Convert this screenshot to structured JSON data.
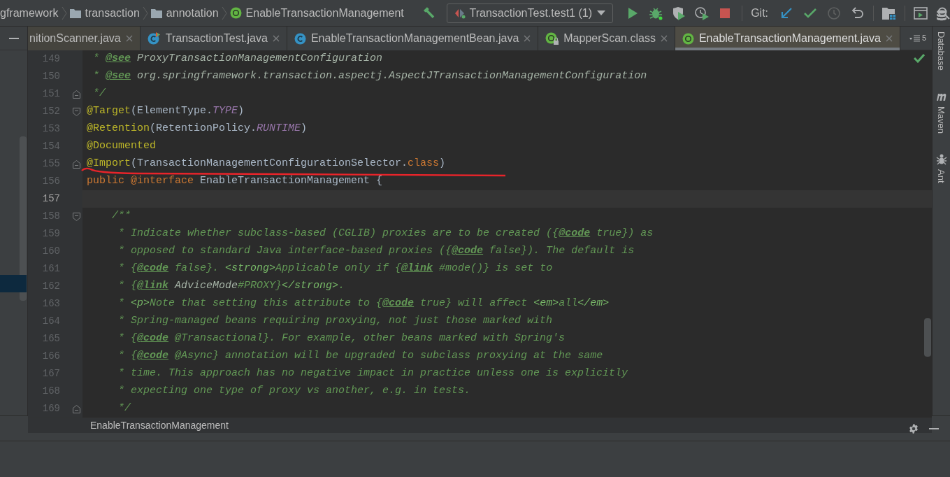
{
  "breadcrumbs": [
    {
      "kind": "plain",
      "label": "gframework"
    },
    {
      "kind": "folder",
      "label": "transaction"
    },
    {
      "kind": "folder",
      "label": "annotation"
    },
    {
      "kind": "annotation",
      "label": "EnableTransactionManagement"
    }
  ],
  "toolbar": {
    "run_config": "TransactionTest.test1 (1)",
    "vcs_label": "Git:"
  },
  "tabs": [
    {
      "kind": "plain",
      "label": "nitionScanner.java",
      "selected": false
    },
    {
      "kind": "test-class",
      "label": "TransactionTest.java",
      "selected": false
    },
    {
      "kind": "class",
      "label": "EnableTransactionManagementBean.java",
      "selected": false
    },
    {
      "kind": "annotation-locked",
      "label": "MapperScan.class",
      "selected": false
    },
    {
      "kind": "annotation",
      "label": "EnableTransactionManagement.java",
      "selected": true
    }
  ],
  "tab_overflow": "5",
  "editor": {
    "lines": [
      {
        "number": "149",
        "current": false,
        "fold_start": false,
        "fold_end": false,
        "tokens": [
          {
            "kind": "doc",
            "text": " * "
          },
          {
            "kind": "doctag",
            "text": "@see"
          },
          {
            "kind": "docref",
            "text": " ProxyTransactionManagementConfiguration"
          }
        ]
      },
      {
        "number": "150",
        "current": false,
        "fold_start": false,
        "fold_end": false,
        "tokens": [
          {
            "kind": "doc",
            "text": " * "
          },
          {
            "kind": "doctag",
            "text": "@see"
          },
          {
            "kind": "docref",
            "text": " org.springframework.transaction.aspectj.AspectJTransactionManagementConfiguration"
          }
        ]
      },
      {
        "number": "151",
        "current": false,
        "fold_start": false,
        "fold_end": true,
        "tokens": [
          {
            "kind": "doc",
            "text": " */"
          }
        ]
      },
      {
        "number": "152",
        "current": false,
        "fold_start": true,
        "fold_end": false,
        "tokens": [
          {
            "kind": "annotation",
            "text": "@Target"
          },
          {
            "kind": "plain",
            "text": "(ElementType."
          },
          {
            "kind": "constant",
            "text": "TYPE"
          },
          {
            "kind": "plain",
            "text": ")"
          }
        ]
      },
      {
        "number": "153",
        "current": false,
        "fold_start": false,
        "fold_end": false,
        "tokens": [
          {
            "kind": "annotation",
            "text": "@Retention"
          },
          {
            "kind": "plain",
            "text": "(RetentionPolicy."
          },
          {
            "kind": "constant",
            "text": "RUNTIME"
          },
          {
            "kind": "plain",
            "text": ")"
          }
        ]
      },
      {
        "number": "154",
        "current": false,
        "fold_start": false,
        "fold_end": false,
        "tokens": [
          {
            "kind": "annotation",
            "text": "@Documented"
          }
        ]
      },
      {
        "number": "155",
        "current": false,
        "fold_start": false,
        "fold_end": true,
        "tokens": [
          {
            "kind": "annotation",
            "text": "@Import"
          },
          {
            "kind": "plain",
            "text": "(TransactionManagementConfigurationSelector."
          },
          {
            "kind": "keyword",
            "text": "class"
          },
          {
            "kind": "plain",
            "text": ")"
          }
        ]
      },
      {
        "number": "156",
        "current": false,
        "fold_start": false,
        "fold_end": false,
        "tokens": [
          {
            "kind": "keyword",
            "text": "public @interface"
          },
          {
            "kind": "plain",
            "text": " EnableTransactionManagement {"
          }
        ]
      },
      {
        "number": "157",
        "current": true,
        "fold_start": false,
        "fold_end": false
      },
      {
        "number": "158",
        "current": false,
        "fold_start": true,
        "fold_end": false,
        "tokens": [
          {
            "kind": "doc",
            "text": "    /**"
          }
        ]
      },
      {
        "number": "159",
        "current": false,
        "fold_start": false,
        "fold_end": false,
        "tokens": [
          {
            "kind": "doc",
            "text": "     * Indicate whether subclass-based (CGLIB) proxies are to be created ({"
          },
          {
            "kind": "doctag",
            "text": "@code"
          },
          {
            "kind": "doc",
            "text": " true}) as"
          }
        ]
      },
      {
        "number": "160",
        "current": false,
        "fold_start": false,
        "fold_end": false,
        "tokens": [
          {
            "kind": "doc",
            "text": "     * opposed to standard Java interface-based proxies ({"
          },
          {
            "kind": "doctag",
            "text": "@code"
          },
          {
            "kind": "doc",
            "text": " false}). The default is"
          }
        ]
      },
      {
        "number": "161",
        "current": false,
        "fold_start": false,
        "fold_end": false,
        "tokens": [
          {
            "kind": "doc",
            "text": "     * {"
          },
          {
            "kind": "doctag",
            "text": "@code"
          },
          {
            "kind": "doc",
            "text": " false}. "
          },
          {
            "kind": "html",
            "text": "<strong>"
          },
          {
            "kind": "doc",
            "text": "Applicable only if {"
          },
          {
            "kind": "doctag",
            "text": "@link"
          },
          {
            "kind": "doc",
            "text": " #mode()} is set to"
          }
        ]
      },
      {
        "number": "162",
        "current": false,
        "fold_start": false,
        "fold_end": false,
        "tokens": [
          {
            "kind": "doc",
            "text": "     * {"
          },
          {
            "kind": "doctag",
            "text": "@link"
          },
          {
            "kind": "docref",
            "text": " AdviceMode"
          },
          {
            "kind": "doc",
            "text": "#PROXY}"
          },
          {
            "kind": "html",
            "text": "</strong>"
          },
          {
            "kind": "doc",
            "text": "."
          }
        ]
      },
      {
        "number": "163",
        "current": false,
        "fold_start": false,
        "fold_end": false,
        "tokens": [
          {
            "kind": "doc",
            "text": "     * "
          },
          {
            "kind": "html",
            "text": "<p>"
          },
          {
            "kind": "doc",
            "text": "Note that setting this attribute to {"
          },
          {
            "kind": "doctag",
            "text": "@code"
          },
          {
            "kind": "doc",
            "text": " true} will affect "
          },
          {
            "kind": "html",
            "text": "<em>"
          },
          {
            "kind": "doc",
            "text": "all"
          },
          {
            "kind": "html",
            "text": "</em>"
          }
        ]
      },
      {
        "number": "164",
        "current": false,
        "fold_start": false,
        "fold_end": false,
        "tokens": [
          {
            "kind": "doc",
            "text": "     * Spring-managed beans requiring proxying, not just those marked with"
          }
        ]
      },
      {
        "number": "165",
        "current": false,
        "fold_start": false,
        "fold_end": false,
        "tokens": [
          {
            "kind": "doc",
            "text": "     * {"
          },
          {
            "kind": "doctag",
            "text": "@code"
          },
          {
            "kind": "doc",
            "text": " @Transactional}. For example, other beans marked with Spring's"
          }
        ]
      },
      {
        "number": "166",
        "current": false,
        "fold_start": false,
        "fold_end": false,
        "tokens": [
          {
            "kind": "doc",
            "text": "     * {"
          },
          {
            "kind": "doctag",
            "text": "@code"
          },
          {
            "kind": "doc",
            "text": " @Async} annotation will be upgraded to subclass proxying at the same"
          }
        ]
      },
      {
        "number": "167",
        "current": false,
        "fold_start": false,
        "fold_end": false,
        "tokens": [
          {
            "kind": "doc",
            "text": "     * time. This approach has no negative impact in practice unless one is explicitly"
          }
        ]
      },
      {
        "number": "168",
        "current": false,
        "fold_start": false,
        "fold_end": false,
        "tokens": [
          {
            "kind": "doc",
            "text": "     * expecting one type of proxy vs another, e.g. in tests."
          }
        ]
      },
      {
        "number": "169",
        "current": false,
        "fold_start": false,
        "fold_end": true,
        "tokens": [
          {
            "kind": "doc",
            "text": "     */"
          }
        ]
      }
    ]
  },
  "editor_breadcrumb": "EnableTransactionManagement",
  "right_stripe": [
    {
      "kind": "database",
      "label": "Database"
    },
    {
      "kind": "maven",
      "label": "Maven"
    },
    {
      "kind": "ant",
      "label": "Ant"
    }
  ]
}
